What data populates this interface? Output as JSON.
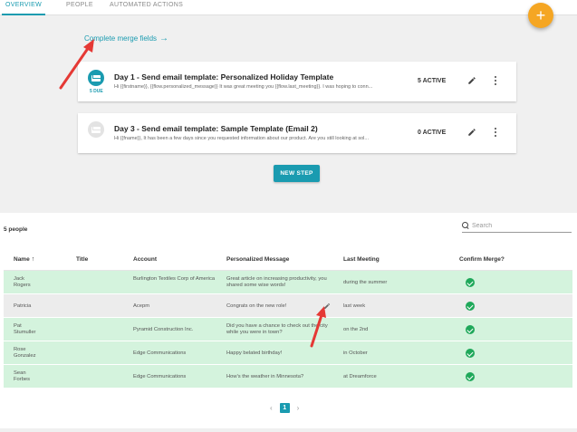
{
  "tabs": [
    {
      "label": "OVERVIEW",
      "active": true
    },
    {
      "label": "PEOPLE",
      "active": false
    },
    {
      "label": "AUTOMATED ACTIONS",
      "active": false
    }
  ],
  "fab": {
    "label": "+",
    "color": "#f5a623"
  },
  "merge_link": {
    "label": "Complete merge fields",
    "arrow": "→"
  },
  "steps": [
    {
      "title": "Day 1 - Send email template: Personalized Holiday Template",
      "preview": "Hi {{firstname}}, {{flow.personalized_message}} It was great meeting you {{flow.last_meeting}}. I was hoping to conn...",
      "badge": "5 DUE",
      "status": "5 ACTIVE"
    },
    {
      "title": "Day 3 - Send email template: Sample Template (Email 2)",
      "preview": "Hi {{fname}}, It has been a few days since you requested information about our product. Are you still looking at sol...",
      "badge": "",
      "status": "0 ACTIVE"
    }
  ],
  "new_step_label": "NEW STEP",
  "people": {
    "count_label": "5 people",
    "search_placeholder": "Search",
    "columns": [
      "Name",
      "Title",
      "Account",
      "Personalized Message",
      "Last Meeting",
      "Confirm Merge?"
    ],
    "sort_indicator": "↑",
    "rows": [
      {
        "name": "Jack\nRogers",
        "title": "",
        "account": "Burlington Textiles Corp of America",
        "message": "Great article on increasing productivity, you shared some wise words!",
        "last_meeting": "during the summer",
        "confirmed": true,
        "highlight": "green"
      },
      {
        "name": "Patricia",
        "title": "",
        "account": "Acepm",
        "message": "Congrats on the new role!",
        "last_meeting": "last week",
        "confirmed": true,
        "highlight": "gray"
      },
      {
        "name": "Pat\nStumuller",
        "title": "",
        "account": "Pyramid Construction Inc.",
        "message": "Did you have a chance to check out the city while you were in town?",
        "last_meeting": "on the 2nd",
        "confirmed": true,
        "highlight": "green"
      },
      {
        "name": "Rose\nGonzalez",
        "title": "",
        "account": "Edge Communications",
        "message": "Happy belated birthday!",
        "last_meeting": "in October",
        "confirmed": true,
        "highlight": "green"
      },
      {
        "name": "Sean\nForbes",
        "title": "",
        "account": "Edge Communications",
        "message": "How's the weather in Minnesota?",
        "last_meeting": "at Dreamforce",
        "confirmed": true,
        "highlight": "green"
      }
    ]
  },
  "pager": {
    "prev": "‹",
    "page": "1",
    "next": "›"
  },
  "colors": {
    "accent": "#1a9bb0",
    "confirm": "#1fa85a",
    "annotation": "#e53935"
  }
}
